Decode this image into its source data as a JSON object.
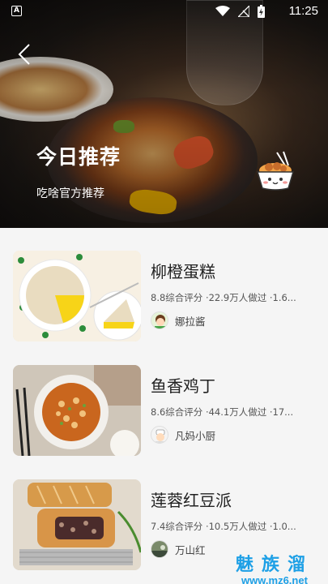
{
  "status": {
    "time": "11:25",
    "a_icon": "A"
  },
  "hero": {
    "title": "今日推荐",
    "subtitle": "吃啥官方推荐"
  },
  "recipes": [
    {
      "title": "柳橙蛋糕",
      "meta": "8.8综合评分 ·22.9万人做过 ·1.6...",
      "author": "娜拉酱"
    },
    {
      "title": "鱼香鸡丁",
      "meta": "8.6综合评分 ·44.1万人做过 ·17...",
      "author": "凡妈小厨"
    },
    {
      "title": "莲蓉红豆派",
      "meta": "7.4综合评分 ·10.5万人做过 ·1.0...",
      "author": "万山红"
    }
  ],
  "watermark": {
    "top": "魅族溜",
    "bottom": "www.mz6.net"
  }
}
